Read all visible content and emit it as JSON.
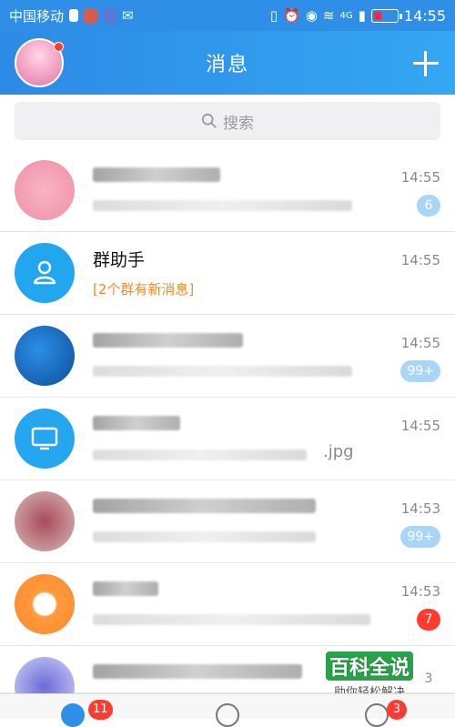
{
  "status_bar": {
    "carrier": "中国移动",
    "network": "4G",
    "time": "14:55"
  },
  "header": {
    "title": "消息",
    "add_icon": "plus-icon"
  },
  "search": {
    "placeholder": "搜索"
  },
  "conversations": [
    {
      "title": "",
      "preview": "",
      "time": "14:55",
      "badge": "6",
      "badge_color": "#a9d6f5"
    },
    {
      "title": "群助手",
      "preview": "[2个群有新消息]",
      "time": "14:55",
      "badge": ""
    },
    {
      "title": "",
      "preview": "",
      "time": "14:55",
      "badge": "99+",
      "badge_color": "#a9d6f5"
    },
    {
      "title": "",
      "preview": ".jpg",
      "time": "14:55",
      "badge": ""
    },
    {
      "title": "",
      "preview": "",
      "time": "14:53",
      "badge": "99+",
      "badge_color": "#a9d6f5"
    },
    {
      "title": "",
      "preview": "",
      "time": "14:53",
      "badge": "7",
      "badge_color": "#ff3b30"
    },
    {
      "title": "",
      "preview": "",
      "time": "",
      "badge": "3",
      "badge_color": "#a9d6f5"
    }
  ],
  "watermark": {
    "title": "百科全说",
    "subtitle": "助你轻松解决"
  },
  "bottom_tabs": {
    "messages_badge": "11",
    "dynamic_badge": "3"
  },
  "colors": {
    "header": "#2f8fe6",
    "badge_blue": "#a9d6f5",
    "badge_red": "#ff3b30",
    "accent_orange": "#f28a2e"
  }
}
